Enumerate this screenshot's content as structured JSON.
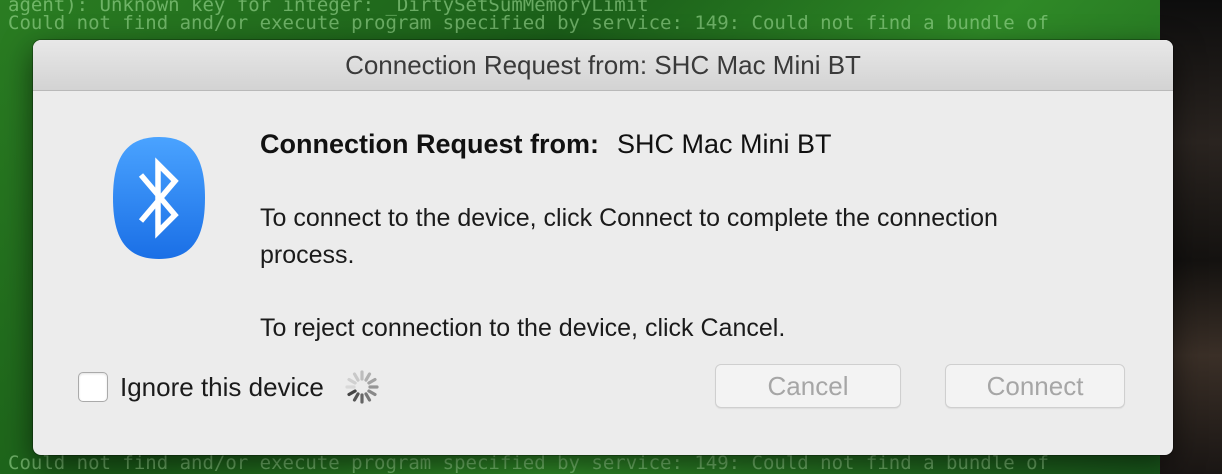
{
  "background": {
    "lines": [
      "agent): Unknown key for integer: _DirtySetSumMemoryLimit",
      "Could not find and/or execute program specified by service: 149: Could not find a bundle of",
      "Could not find and/or execute program specified by service: 149: Could not find a bundle of"
    ]
  },
  "dialog": {
    "title": "Connection Request from: SHC Mac Mini BT",
    "heading_label": "Connection Request from:",
    "device_name": "SHC Mac Mini BT",
    "message_connect": "To connect to the device, click Connect to complete the connection process.",
    "message_reject": "To reject connection to the device, click Cancel.",
    "ignore_label": "Ignore this device",
    "ignore_checked": false,
    "cancel_label": "Cancel",
    "connect_label": "Connect",
    "icons": {
      "bluetooth": "bluetooth-icon",
      "spinner": "loading-spinner-icon"
    },
    "colors": {
      "bluetooth_blue": "#1f7cf0",
      "disabled_text": "#a6a6a6"
    }
  }
}
